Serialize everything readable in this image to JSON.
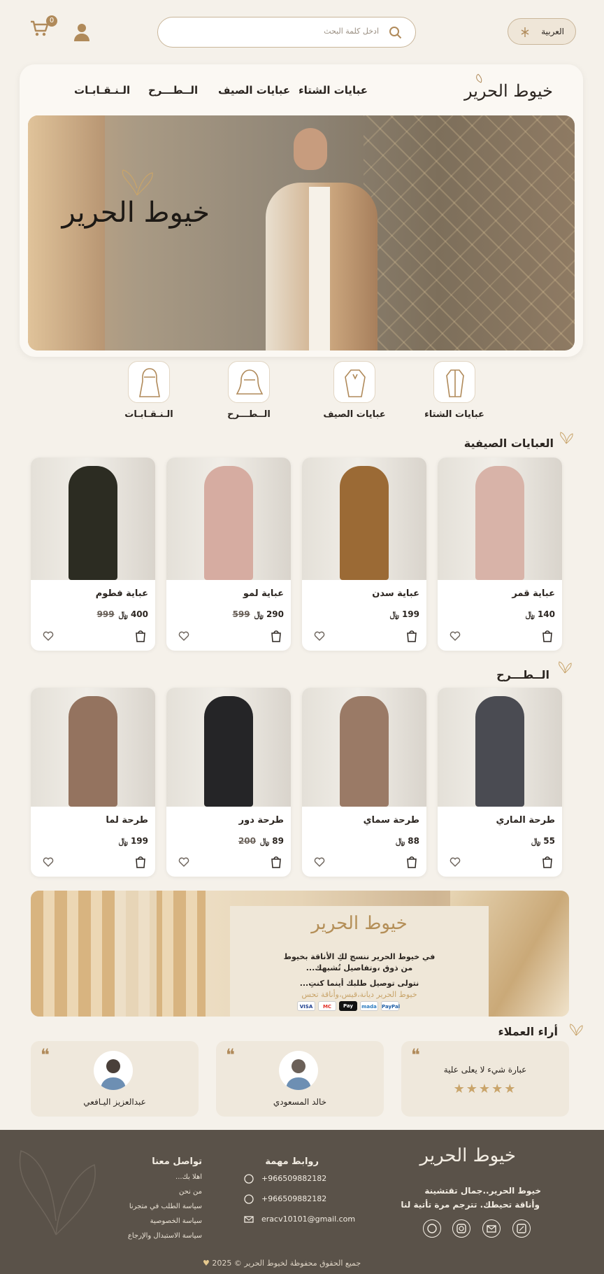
{
  "header": {
    "cart_count": "0",
    "search_placeholder": "ادخل كلمة البحث",
    "language_label": "العربية"
  },
  "brand": {
    "logo_text": "خيوط الحرير"
  },
  "nav": {
    "items": [
      "عبايات الشتاء",
      "عبايات الصيف",
      "الــطـــرح",
      "الـنـقـابـات"
    ]
  },
  "categories": [
    {
      "label": "عبايات الشتاء",
      "icon": "winter-abaya-icon"
    },
    {
      "label": "عبايات الصيف",
      "icon": "summer-abaya-icon"
    },
    {
      "label": "الــطـــرح",
      "icon": "scarf-icon"
    },
    {
      "label": "الـنـقـابـات",
      "icon": "niqab-icon"
    }
  ],
  "summer_section": {
    "title": "العبايات الصيفية",
    "products": [
      {
        "name": "عباية قمر",
        "price": "140",
        "old_price": "",
        "currency": "﷼",
        "color": "#d8b3a8"
      },
      {
        "name": "عباية سدن",
        "price": "199",
        "old_price": "",
        "currency": "﷼",
        "color": "#9b6a35"
      },
      {
        "name": "عباية لمو",
        "price": "290",
        "old_price": "599",
        "currency": "﷼",
        "color": "#d6aca1"
      },
      {
        "name": "عباية فطوم",
        "price": "400",
        "old_price": "999",
        "currency": "﷼",
        "color": "#2c2c22"
      }
    ]
  },
  "scarves_section": {
    "title": "الــطـــرح",
    "products": [
      {
        "name": "طرحة الماري",
        "price": "55",
        "old_price": "",
        "currency": "﷼",
        "color": "#4a4b52"
      },
      {
        "name": "طرحة سماي",
        "price": "88",
        "old_price": "",
        "currency": "﷼",
        "color": "#9a7a66"
      },
      {
        "name": "طرحة دور",
        "price": "89",
        "old_price": "200",
        "currency": "﷼",
        "color": "#252527"
      },
      {
        "name": "طرحة لما",
        "price": "199",
        "old_price": "",
        "currency": "﷼",
        "color": "#94735f"
      }
    ]
  },
  "banner": {
    "logo_text": "خيوط الحرير",
    "line1": "في خيوط الحرير ننسج لكِ الأناقة بخيوط",
    "line2": "من ذوق ،وتفاصيل تُشبهك...",
    "line3": "نتولى توصيل طلبك أينما كنتِ...",
    "line4": "خيوط الحرير ديانة،قيس،وأناقة تحس",
    "payments": [
      "VISA",
      "MC",
      "Pay",
      "mada",
      "PayPal"
    ]
  },
  "reviews": {
    "title": "أراء العملاء",
    "items": [
      {
        "text": "عبارة شيء لا يعلى علية",
        "stars": 5,
        "name": ""
      },
      {
        "text": "",
        "stars": 0,
        "name": "خالد المسعودي"
      },
      {
        "text": "",
        "stars": 0,
        "name": "عبدالعزيز اليـافعي"
      }
    ]
  },
  "footer": {
    "logo_text": "خيوط الحرير",
    "tagline1": "خيوط الحرير..جمال تقتشينة",
    "tagline2": "وأناقة تحيطك. تترجم مرة تأتية لنا",
    "links_title": "روابط مهمة",
    "contact_title": "تواصل معنا",
    "contacts": [
      "+966509882182",
      "+966509882182",
      "eracv10101@gmail.com"
    ],
    "links": [
      "اهلا بك...",
      "من نحن",
      "سياسة الطلب في متجرنا",
      "سياسة الخصوصية",
      "سياسة الاستبدال والإرجاع"
    ],
    "copyright": "جميع الحقوق محفوظة لخيوط الحرير © 2025"
  },
  "colors": {
    "accent": "#b08a5a",
    "background": "#f5f1ea",
    "footer": "#5a5249"
  }
}
